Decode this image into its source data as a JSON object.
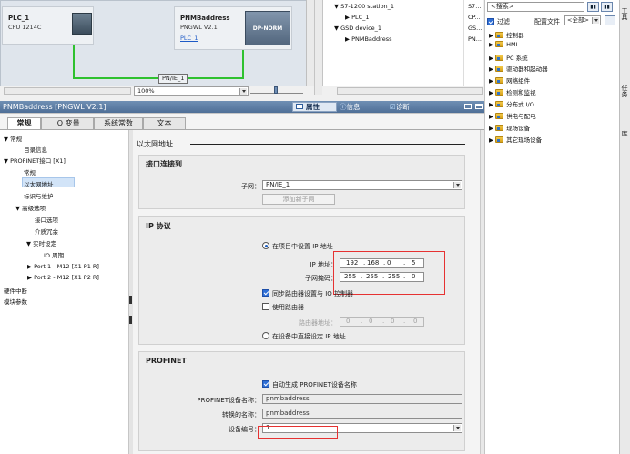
{
  "network": {
    "plc": {
      "name": "PLC_1",
      "type": "CPU 1214C"
    },
    "pnm": {
      "name": "PNMBaddress",
      "type": "PNGWL V2.1",
      "link": "PLC_1",
      "tag": "DP-NORM"
    },
    "bus_label": "PN/IE_1",
    "zoom": "100%"
  },
  "device_tree": {
    "rows": [
      {
        "label": "S7-1200 station_1",
        "col": "S7..."
      },
      {
        "label": "PLC_1",
        "col": "CP..."
      },
      {
        "label": "GSD device_1",
        "col": "GS..."
      },
      {
        "label": "PNMBaddress",
        "col": "PN..."
      }
    ]
  },
  "catalog": {
    "search_placeholder": "<搜索>",
    "filter_label": "过滤",
    "profile_label": "配置文件",
    "profile_value": "<全部>",
    "items": [
      "控制器",
      "HMI",
      "PC 系统",
      "驱动器和起动器",
      "网络组件",
      "检测和监视",
      "分布式 I/O",
      "供电与配电",
      "现场设备",
      "其它现场设备"
    ]
  },
  "side_tabs": [
    "任务",
    "库",
    "工具"
  ],
  "inspector": {
    "title": "PNMBaddress [PNGWL V2.1]",
    "prop_tabs": [
      "属性",
      "信息",
      "诊断"
    ],
    "tabs": [
      "常规",
      "IO 变量",
      "系统常数",
      "文本"
    ],
    "nav": [
      {
        "label": "常规",
        "indent": 0,
        "arrow": "▼"
      },
      {
        "label": "目录信息",
        "indent": 2,
        "arrow": ""
      },
      {
        "label": "PROFINET接口 [X1]",
        "indent": 0,
        "arrow": "▼"
      },
      {
        "label": "常规",
        "indent": 2,
        "arrow": ""
      },
      {
        "label": "以太网地址",
        "indent": 2,
        "arrow": "",
        "selected": true
      },
      {
        "label": "标识与维护",
        "indent": 2,
        "arrow": ""
      },
      {
        "label": "高级选项",
        "indent": 1,
        "arrow": "▼"
      },
      {
        "label": "接口选项",
        "indent": 3,
        "arrow": ""
      },
      {
        "label": "介质冗余",
        "indent": 3,
        "arrow": ""
      },
      {
        "label": "实时设定",
        "indent": 2,
        "arrow": "▼"
      },
      {
        "label": "IO 周期",
        "indent": 4,
        "arrow": ""
      },
      {
        "label": "Port 1 - M12 [X1 P1 R]",
        "indent": 2,
        "arrow": "▶"
      },
      {
        "label": "Port 2 - M12 [X1 P2 R]",
        "indent": 2,
        "arrow": "▶"
      },
      {
        "label": "硬件中断",
        "indent": 0,
        "arrow": ""
      },
      {
        "label": "模块参数",
        "indent": 0,
        "arrow": ""
      }
    ],
    "section_title": "以太网地址",
    "iface": {
      "title": "接口连接到",
      "subnet_label": "子网：",
      "subnet_value": "PN/IE_1",
      "add_subnet": "添加新子网"
    },
    "ip": {
      "title": "IP 协议",
      "set_in_project": "在项目中设置 IP 地址",
      "ip_label": "IP 地址：",
      "ip": [
        "192",
        "168",
        "0",
        "5"
      ],
      "mask_label": "子网掩码：",
      "mask": [
        "255",
        "255",
        "255",
        "0"
      ],
      "sync_router": "同步路由器设置与 IO 控制器",
      "use_router": "使用路由器",
      "router_label": "路由器地址：",
      "router": [
        "0",
        "0",
        "0",
        "0"
      ],
      "set_on_device": "在设备中直接设定 IP 地址"
    },
    "profinet": {
      "title": "PROFINET",
      "auto_name": "自动生成 PROFINET设备名称",
      "name_label": "PROFINET设备名称：",
      "name_value": "pnmbaddress",
      "conv_label": "转换的名称：",
      "conv_value": "pnmbaddress",
      "devnum_label": "设备编号：",
      "devnum_value": "1"
    }
  },
  "colors": {
    "highlight": "#e63232",
    "accent": "#1f5fbf"
  }
}
